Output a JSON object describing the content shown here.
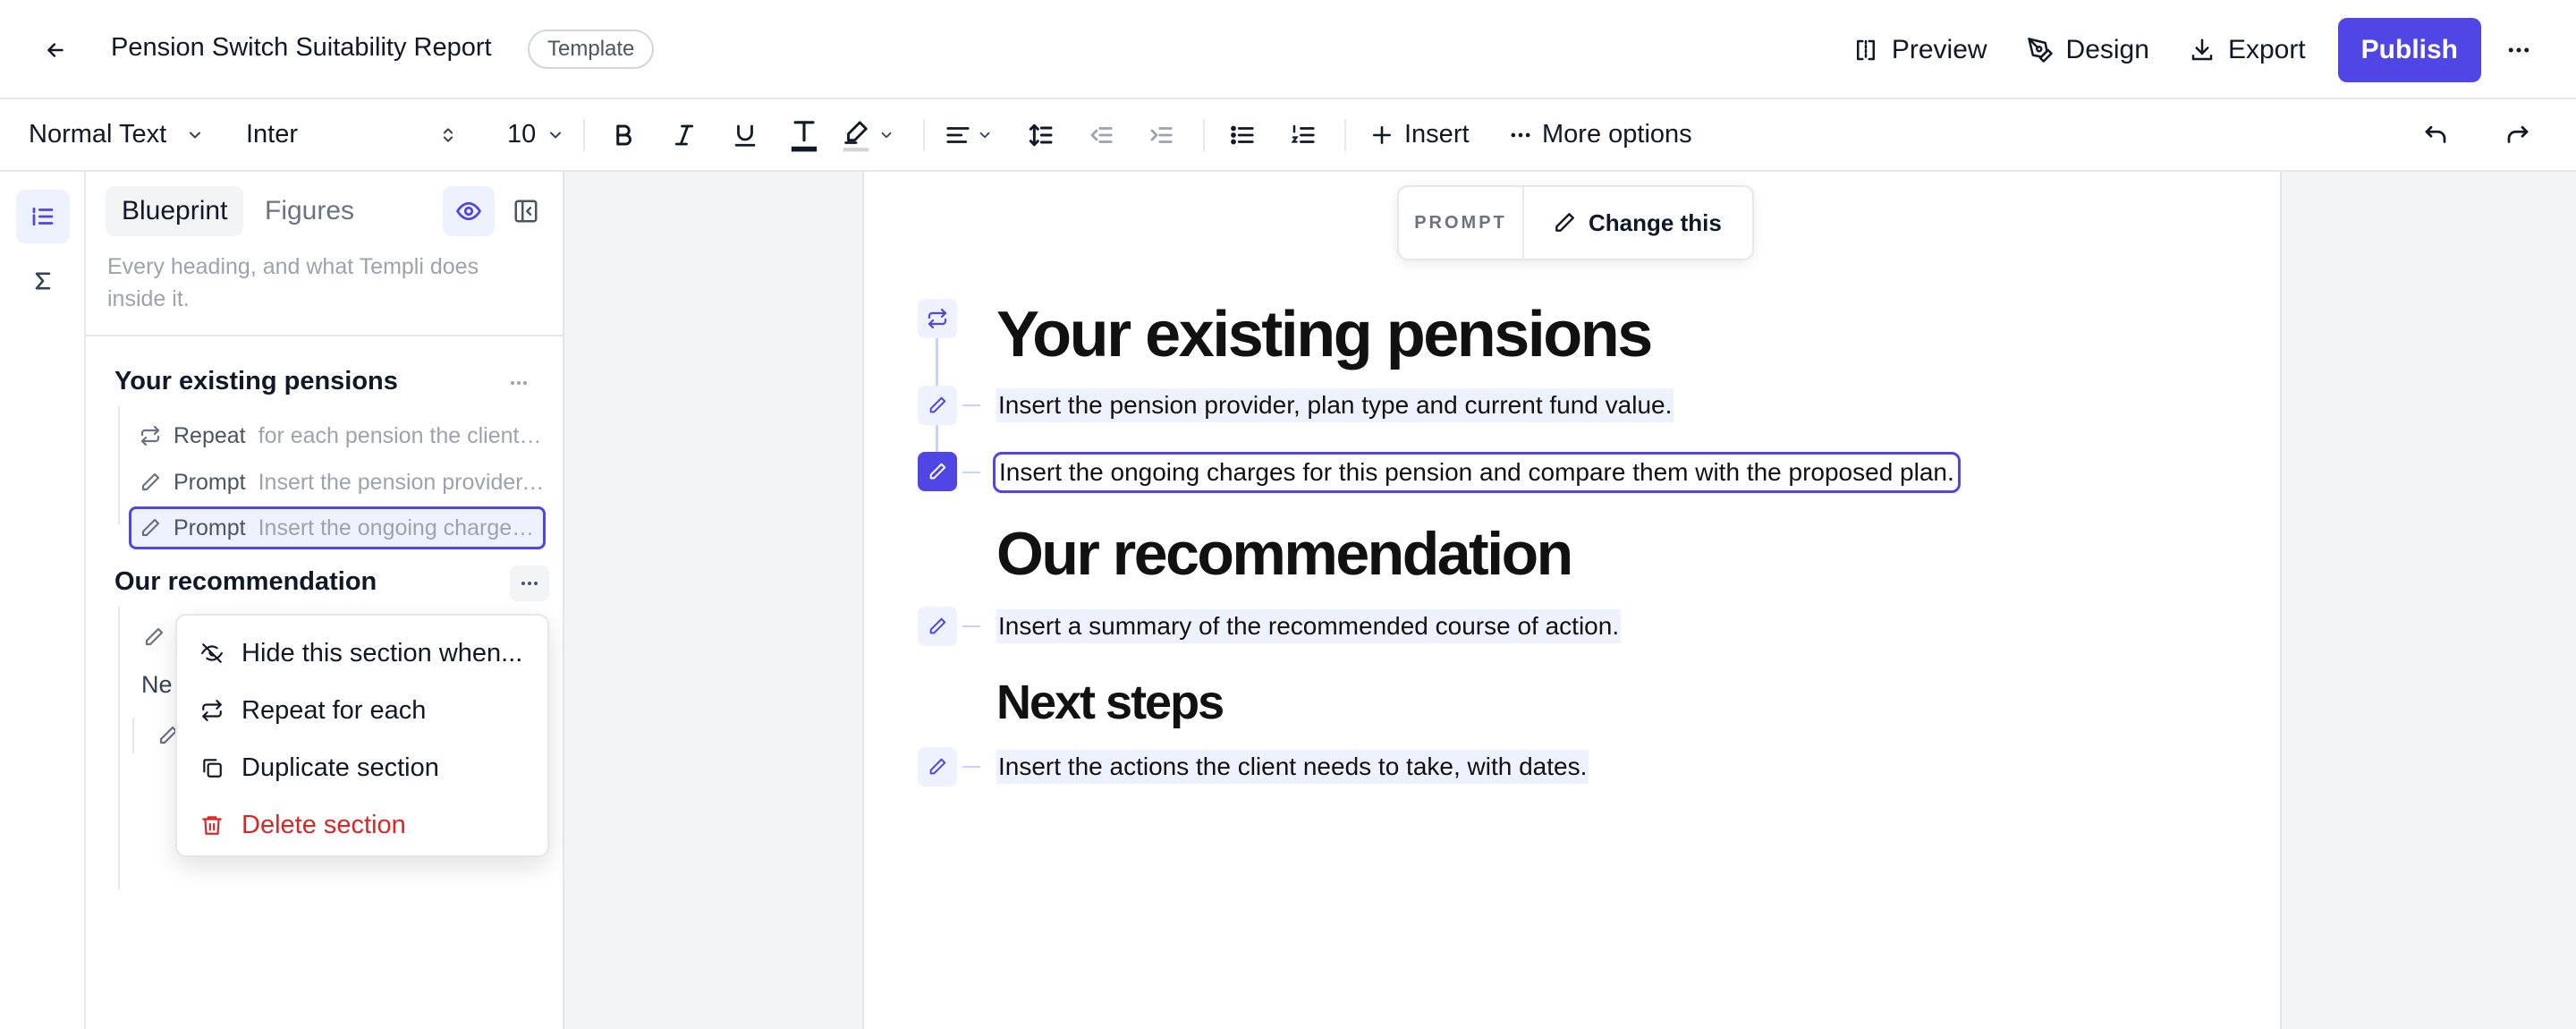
{
  "header": {
    "title": "Pension Switch Suitability Report",
    "badge": "Template",
    "actions": {
      "preview": "Preview",
      "design": "Design",
      "export": "Export",
      "publish": "Publish"
    }
  },
  "toolbar": {
    "text_style": "Normal Text",
    "font": "Inter",
    "font_size": "10",
    "insert": "Insert",
    "more_options": "More options"
  },
  "sidebar": {
    "tabs": {
      "blueprint": "Blueprint",
      "figures": "Figures"
    },
    "description": "Every heading, and what Templi does inside it.",
    "sections": [
      {
        "title": "Your existing pensions",
        "items": [
          {
            "kind": "Repeat",
            "desc": "for each pension the client holds",
            "icon": "repeat-icon"
          },
          {
            "kind": "Prompt",
            "desc": "Insert the pension provider, plan type and current fund value.",
            "icon": "pencil-icon"
          },
          {
            "kind": "Prompt",
            "desc": "Insert the ongoing charges for this pension and compare them with the proposed plan.",
            "icon": "pencil-icon",
            "selected": true
          }
        ]
      },
      {
        "title": "Our recommendation",
        "obscured_label": "Ne"
      }
    ],
    "context_menu": [
      {
        "label": "Hide this section when...",
        "icon": "eye-off-icon"
      },
      {
        "label": "Repeat for each",
        "icon": "repeat-icon"
      },
      {
        "label": "Duplicate section",
        "icon": "copy-icon"
      },
      {
        "label": "Delete section",
        "icon": "trash-icon",
        "danger": true
      }
    ]
  },
  "prompt_pill": {
    "label": "PROMPT",
    "action": "Change this"
  },
  "document": {
    "h1_existing": "Your existing pensions",
    "p_provider": "Insert the pension provider, plan type and current fund value.",
    "p_charges": "Insert the ongoing charges for this pension and compare them with the proposed plan.",
    "h1_recommendation": "Our recommendation",
    "p_summary": "Insert a summary of the recommended course of action.",
    "h2_next": "Next steps",
    "p_actions": "Insert the actions the client needs to take, with dates."
  },
  "colors": {
    "accent": "#4f46e5",
    "accent_light": "#eef2ff",
    "danger": "#dc2626",
    "canvas_bg": "#f3f4f6"
  }
}
